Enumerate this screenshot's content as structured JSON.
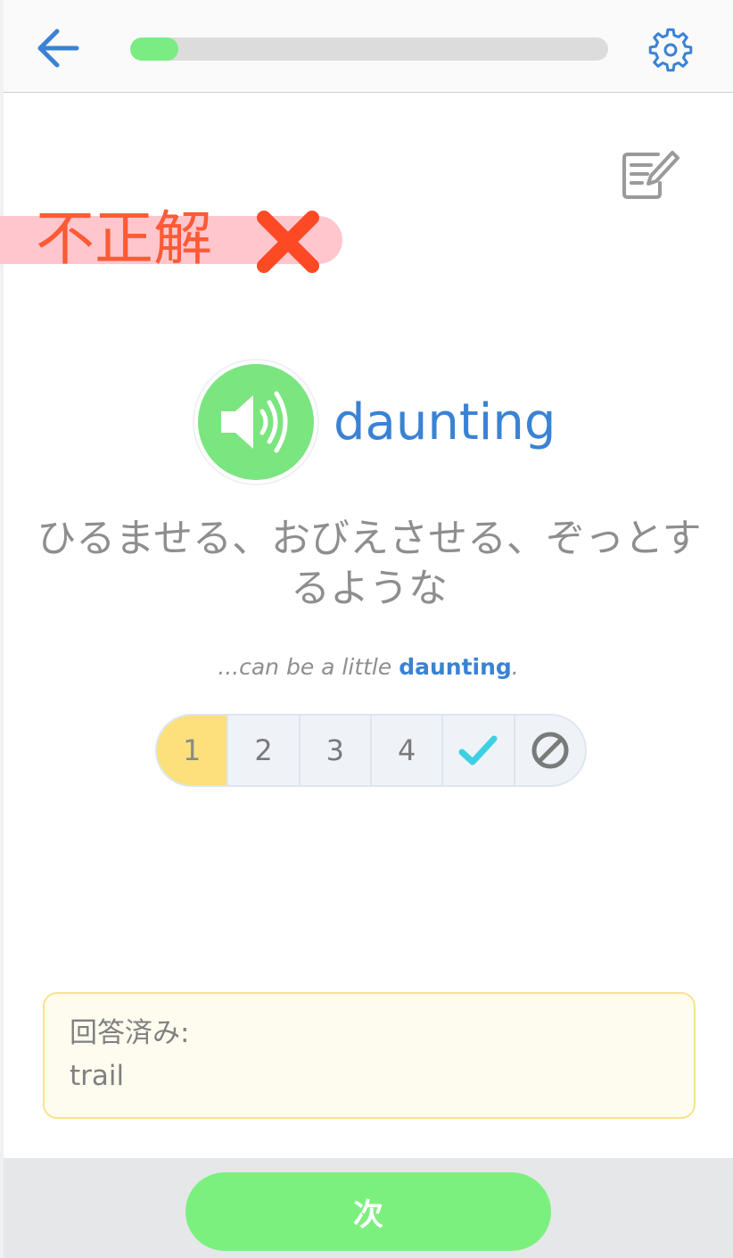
{
  "header": {
    "back_icon": "arrow-left-icon",
    "progress_percent": 10,
    "progress_color": "#7bec83",
    "settings_icon": "gear-icon"
  },
  "note_icon": "edit-note-icon",
  "result": {
    "label": "不正解",
    "icon": "cross-icon",
    "color": "#fd5a36",
    "banner_color": "#ffc7cd"
  },
  "card": {
    "audio_icon": "speaker-icon",
    "word": "daunting",
    "meaning": "ひるませる、おびえさせる、ぞっとするような",
    "example_prefix": "...can be a little ",
    "example_highlight": "daunting",
    "example_suffix": "."
  },
  "rating": {
    "options": [
      "1",
      "2",
      "3",
      "4"
    ],
    "selected": "1",
    "known_icon": "checkmark-icon",
    "skip_icon": "prohibited-icon"
  },
  "answered": {
    "label": "回答済み:",
    "value": "trail"
  },
  "footer": {
    "next_label": "次"
  },
  "colors": {
    "accent_blue": "#3a82d4",
    "green": "#7cf07f",
    "selected_yellow": "#fbe07c"
  }
}
